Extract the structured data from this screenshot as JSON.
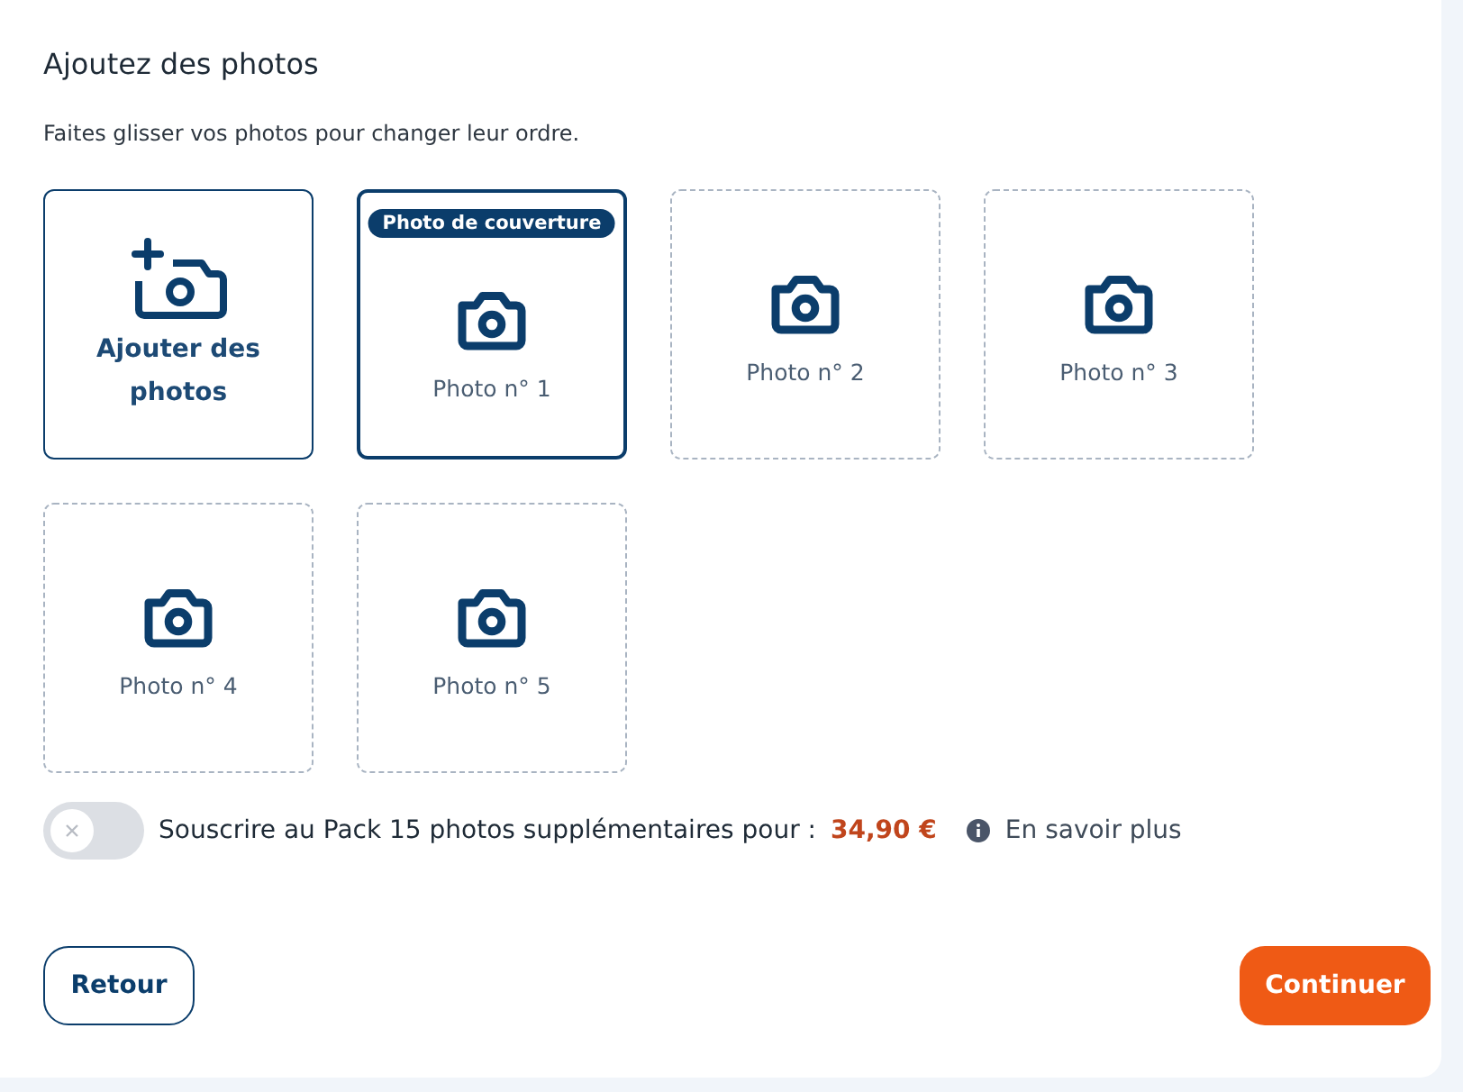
{
  "title": "Ajoutez des photos",
  "hint": "Faites glisser vos photos pour changer leur ordre.",
  "slots": [
    {
      "kind": "add",
      "label": "Ajouter des photos"
    },
    {
      "kind": "photo",
      "label": "Photo n° 1",
      "filled": true,
      "badge": "Photo de couverture"
    },
    {
      "kind": "photo",
      "label": "Photo n° 2",
      "filled": false
    },
    {
      "kind": "photo",
      "label": "Photo n° 3",
      "filled": false
    },
    {
      "kind": "photo",
      "label": "Photo n° 4",
      "filled": false
    },
    {
      "kind": "photo",
      "label": "Photo n° 5",
      "filled": false
    }
  ],
  "pack": {
    "on": false,
    "label": "Souscrire au Pack 15 photos supplémentaires pour :",
    "price": "34,90 €",
    "more": "En savoir plus"
  },
  "buttons": {
    "back": "Retour",
    "next": "Continuer"
  }
}
